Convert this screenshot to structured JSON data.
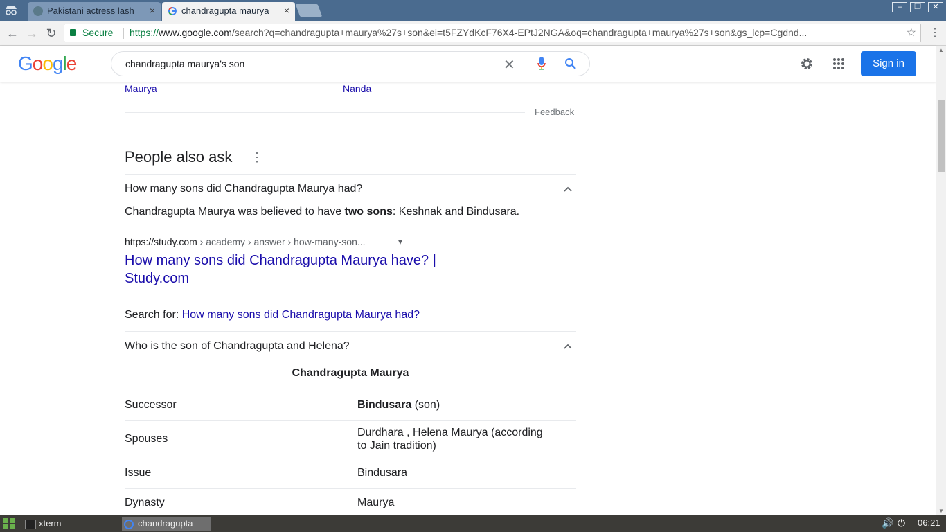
{
  "browser": {
    "tabs": [
      {
        "title": "Pakistani actress lash",
        "close": "×"
      },
      {
        "title": "chandragupta maurya",
        "close": "×"
      }
    ],
    "window_controls": {
      "minimize": "–",
      "restore": "❐",
      "close": "✕"
    },
    "nav": {
      "back": "←",
      "forward": "→",
      "reload": "↻"
    },
    "secure_label": "Secure",
    "url_scheme": "https://",
    "url_host": "www.google.com",
    "url_rest": "/search?q=chandragupta+maurya%27s+son&ei=t5FZYdKcF76X4-EPtJ2NGA&oq=chandragupta+maurya%27s+son&gs_lcp=Cgdnd...",
    "bookmark_star": "☆",
    "menu_dots": "⋮"
  },
  "google": {
    "logo_letters": [
      {
        "ch": "G",
        "color": "#4285f4"
      },
      {
        "ch": "o",
        "color": "#ea4335"
      },
      {
        "ch": "o",
        "color": "#fbbc05"
      },
      {
        "ch": "g",
        "color": "#4285f4"
      },
      {
        "ch": "l",
        "color": "#34a853"
      },
      {
        "ch": "e",
        "color": "#ea4335"
      }
    ],
    "query": "chandragupta maurya's son",
    "clear": "✕",
    "signin": "Sign in"
  },
  "results": {
    "prev_links": [
      "Maurya",
      "Nanda"
    ],
    "feedback": "Feedback",
    "paa_title": "People also ask",
    "paa_more": "⋮",
    "q1": "How many sons did Chandragupta Maurya had?",
    "a1_pre": "Chandragupta Maurya was believed to have ",
    "a1_bold": "two sons",
    "a1_post": ": Keshnak and Bindusara.",
    "cite_domain": "https://study.com",
    "cite_path": " › academy › answer › how-many-son...",
    "cite_caret": "▾",
    "result_title_line1": "How many sons did Chandragupta Maurya have? |",
    "result_title_line2": "Study.com",
    "search_for_label": "Search for: ",
    "search_for_link": "How many sons did Chandragupta Maurya had?",
    "q2": "Who is the son of Chandragupta and Helena?",
    "infobox_title": "Chandragupta Maurya",
    "infobox_rows": [
      {
        "label": "Successor",
        "value_bold": "Bindusara",
        "value": " (son)"
      },
      {
        "label": "Spouses",
        "value_bold": "",
        "value": "Durdhara , Helena Maurya (according",
        "value2": "to Jain tradition)"
      },
      {
        "label": "Issue",
        "value_bold": "",
        "value": "Bindusara"
      },
      {
        "label": "Dynasty",
        "value_bold": "",
        "value": "Maurya"
      }
    ]
  },
  "taskbar": {
    "items": [
      {
        "label": "xterm"
      },
      {
        "label": "chandragupta"
      }
    ],
    "clock": "06:21"
  },
  "colors": {
    "link": "#1a0dab",
    "signin_bg": "#1a73e8",
    "secure": "#0b8043"
  }
}
